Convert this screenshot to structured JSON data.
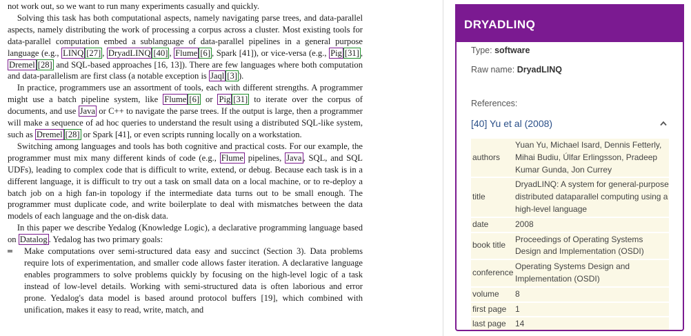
{
  "paper": {
    "p0": "not work out, so we want to run many experiments casually and quickly.",
    "p1a": "Solving this task has both computational aspects, namely navigating parse trees, and data-parallel aspects, namely distributing the work of processing a corpus across a cluster. Most existing tools for data-parallel computation embed a sublanguage of data-parallel pipelines in a general purpose language (e.g., ",
    "linq": "LINQ",
    "ref27": "[27]",
    "dryadlinq": "DryadLINQ",
    "ref40": "[40]",
    "flume": "Flume",
    "ref6": "[6]",
    "p1b": ", Spark [41]), or vice-versa (e.g., ",
    "pig": "Pig",
    "ref31": "[31]",
    "dremel": "Dremel",
    "ref28": "[28]",
    "p1c": " and SQL-based approaches [16, 13]). There are few languages where both computation and data-parallelism are first class (a notable exception is ",
    "jaql": "Jaql",
    "ref3": "[3]",
    "p1d": ").",
    "p2a": "In practice, programmers use an assortment of tools, each with different strengths. A programmer might use a batch pipeline system, like ",
    "p2b": " or ",
    "p2c": " to iterate over the corpus of documents, and use ",
    "java": "Java",
    "p2d": " or C++ to navigate the parse trees. If the output is large, then a programmer will make a sequence of ad hoc queries to understand the result using a distributed SQL-like system, such as ",
    "p2e": " or Spark [41], or even scripts running locally on a workstation.",
    "p3a": "Switching among languages and tools has both cognitive and practical costs. For our example, the programmer must mix many different kinds of code (e.g., ",
    "p3b": " pipelines, ",
    "p3c": ", SQL, and SQL UDFs), leading to complex code that is difficult to write, extend, or debug. Because each task is in a different language, it is difficult to try out a task on small data on a local machine, or to re-deploy a batch job on a high fan-in topology if the intermediate data turns out to be small enough. The programmer must duplicate code, and write boilerplate to deal with mismatches between the data models of each language and the on-disk data.",
    "p4a": "In this paper we describe Yedalog (Knowledge Logic), a declarative programming language based on ",
    "datalog": "Datalog",
    "p4b": ". Yedalog has two primary goals:",
    "b1": "Make computations over semi-structured data easy and succinct (Section 3). Data problems require lots of experimentation, and smaller code allows faster iteration. A declarative language enables programmers to solve problems quickly by focusing on the high-level logic of a task instead of low-level details. Working with semi-structured data is often laborious and error prone. Yedalog's data model is based around protocol buffers [19], which combined with unification, makes it easy to read, write, match, and"
  },
  "panel": {
    "title": "DRYADLINQ",
    "type_label": "Type:",
    "type_value": "software",
    "raw_label": "Raw name:",
    "raw_value": "DryadLINQ",
    "refs_label": "References:",
    "ref_link": "[40] Yu et al (2008)",
    "rows": [
      {
        "k": "authors",
        "v": "Yuan Yu, Michael Isard, Dennis Fetterly, Mihai Budiu, Úlfar Erlingsson, Pradeep Kumar Gunda, Jon Currey"
      },
      {
        "k": "title",
        "v": "DryadLINQ: A system for general-purpose distributed dataparallel computing using a high-level language"
      },
      {
        "k": "date",
        "v": "2008"
      },
      {
        "k": "book title",
        "v": "Proceedings of Operating Systems Design and Implementation (OSDI)"
      },
      {
        "k": "conference",
        "v": "Operating Systems Design and Implementation (OSDI)"
      },
      {
        "k": "volume",
        "v": "8"
      },
      {
        "k": "first page",
        "v": "1"
      },
      {
        "k": "last page",
        "v": "14"
      }
    ]
  },
  "colors": {
    "accent": "#7b1a91",
    "link": "#2a4f88",
    "cell_bg": "#fbf8e6",
    "green_box": "#1f8c2a"
  }
}
